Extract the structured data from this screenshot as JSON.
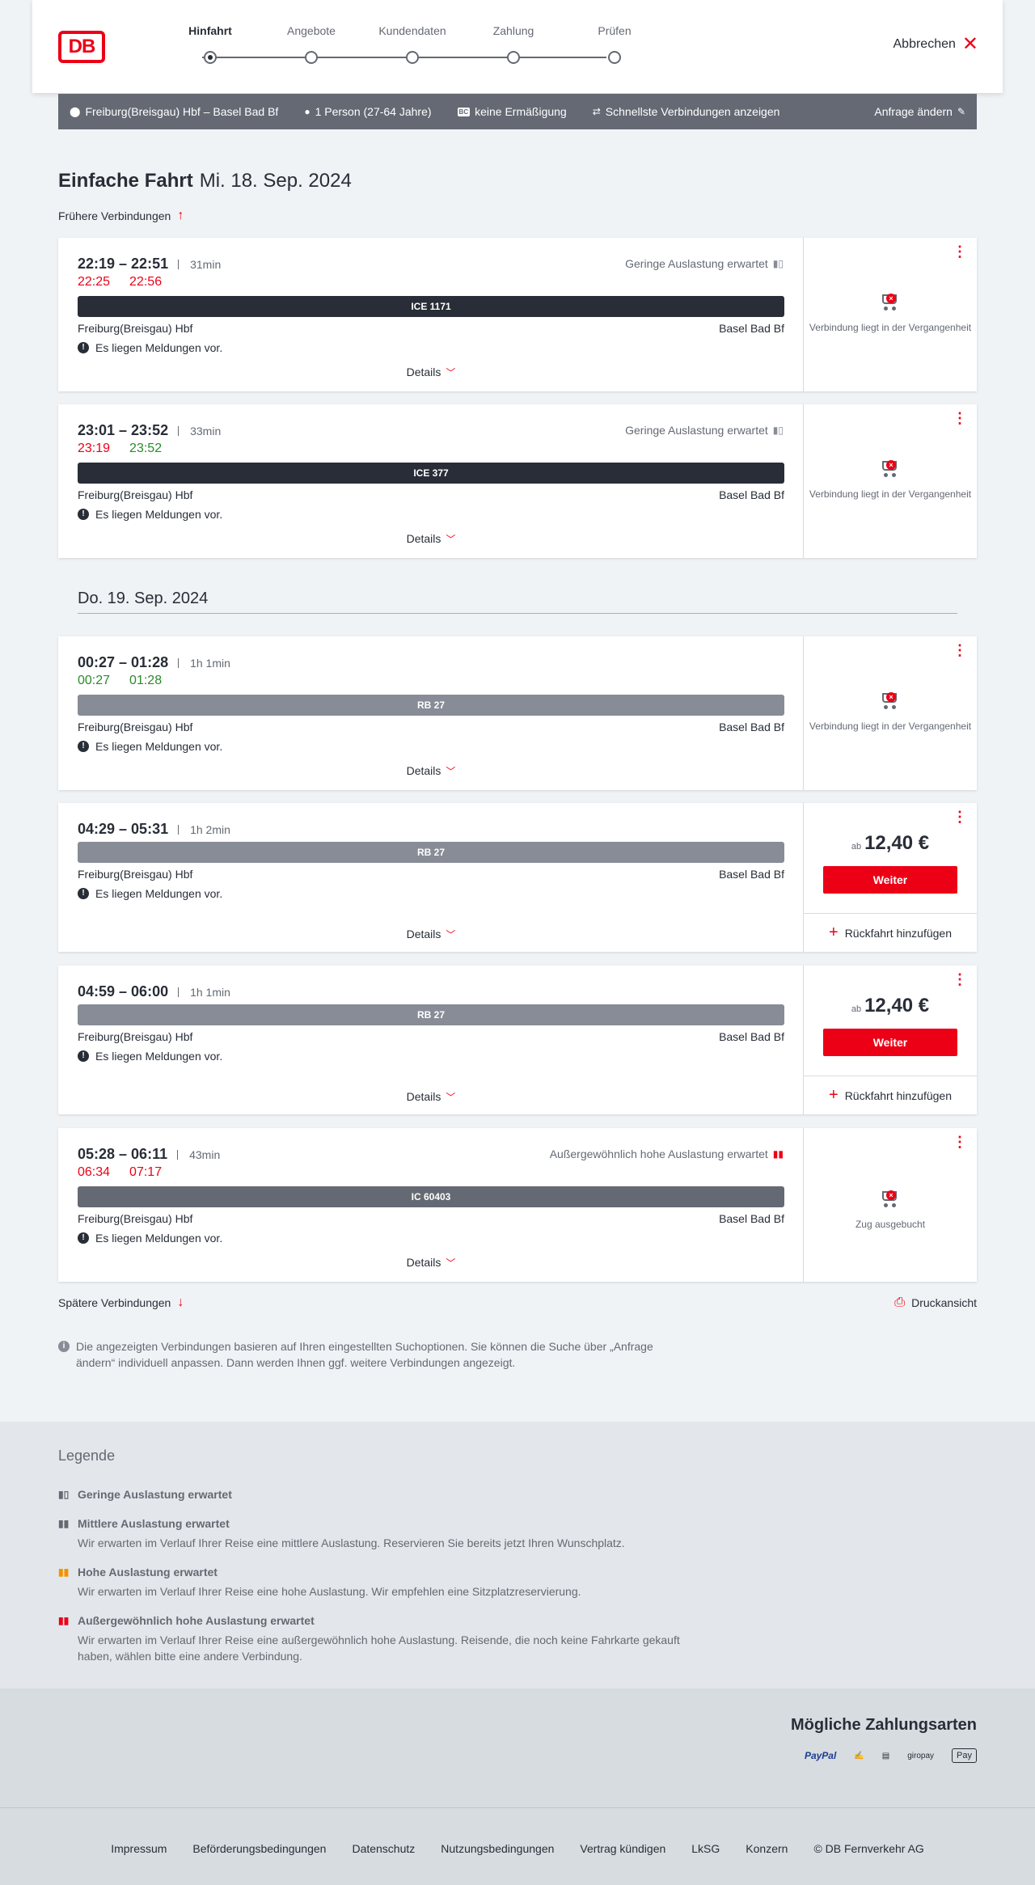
{
  "header": {
    "logo": "DB",
    "steps": [
      {
        "label": "Hinfahrt"
      },
      {
        "label": "Angebote"
      },
      {
        "label": "Kundendaten"
      },
      {
        "label": "Zahlung"
      },
      {
        "label": "Prüfen"
      }
    ],
    "cancel_label": "Abbrechen"
  },
  "search": {
    "route": "Freiburg(Breisgau) Hbf – Basel Bad Bf",
    "travellers": "1 Person (27-64 Jahre)",
    "discount_badge": "BC",
    "discount": "keine Ermäßigung",
    "fastest": "Schnellste Verbindungen anzeigen",
    "change": "Anfrage ändern"
  },
  "page": {
    "title": "Einfache Fahrt",
    "date": "Mi. 18. Sep. 2024",
    "earlier": "Frühere Verbindungen",
    "date2": "Do. 19. Sep. 2024",
    "later": "Spätere Verbindungen",
    "print": "Druckansicht",
    "info": "Die angezeigten Verbindungen basieren auf Ihren eingestellten Suchoptionen. Sie können die Suche über „Anfrage ändern“ individuell anpassen. Dann werden Ihnen ggf. weitere Verbindungen angezeigt."
  },
  "connections": [
    {
      "times": "22:19 – 22:51",
      "duration": "31min",
      "rt_dep": "22:25",
      "rt_arr": "22:56",
      "load": "Geringe Auslastung erwartet",
      "train": "ICE 1171",
      "from": "Freiburg(Breisgau) Hbf",
      "to": "Basel Bad Bf",
      "message": "Es liegen Meldungen vor.",
      "details": "Details",
      "status": "Verbindung liegt in der Vergangenheit"
    },
    {
      "times": "23:01 – 23:52",
      "duration": "33min",
      "rt_dep": "23:19",
      "rt_arr": "23:52",
      "load": "Geringe Auslastung erwartet",
      "train": "ICE 377",
      "from": "Freiburg(Breisgau) Hbf",
      "to": "Basel Bad Bf",
      "message": "Es liegen Meldungen vor.",
      "details": "Details",
      "status": "Verbindung liegt in der Vergangenheit"
    },
    {
      "times": "00:27 – 01:28",
      "duration": "1h 1min",
      "rt_dep": "00:27",
      "rt_arr": "01:28",
      "train": "RB 27",
      "from": "Freiburg(Breisgau) Hbf",
      "to": "Basel Bad Bf",
      "message": "Es liegen Meldungen vor.",
      "details": "Details",
      "status": "Verbindung liegt in der Vergangenheit"
    },
    {
      "times": "04:29 – 05:31",
      "duration": "1h 2min",
      "train": "RB 27",
      "from": "Freiburg(Breisgau) Hbf",
      "to": "Basel Bad Bf",
      "message": "Es liegen Meldungen vor.",
      "details": "Details",
      "price_prefix": "ab",
      "price": "12,40 €",
      "continue": "Weiter",
      "return": "Rückfahrt hinzufügen"
    },
    {
      "times": "04:59 – 06:00",
      "duration": "1h 1min",
      "train": "RB 27",
      "from": "Freiburg(Breisgau) Hbf",
      "to": "Basel Bad Bf",
      "message": "Es liegen Meldungen vor.",
      "details": "Details",
      "price_prefix": "ab",
      "price": "12,40 €",
      "continue": "Weiter",
      "return": "Rückfahrt hinzufügen"
    },
    {
      "times": "05:28 – 06:11",
      "duration": "43min",
      "rt_dep": "06:34",
      "rt_arr": "07:17",
      "load": "Außergewöhnlich hohe Auslastung erwartet",
      "train": "IC 60403",
      "from": "Freiburg(Breisgau) Hbf",
      "to": "Basel Bad Bf",
      "message": "Es liegen Meldungen vor.",
      "details": "Details",
      "status": "Zug ausgebucht"
    }
  ],
  "legend": {
    "title": "Legende",
    "items": [
      {
        "title": "Geringe Auslastung erwartet",
        "desc": ""
      },
      {
        "title": "Mittlere Auslastung erwartet",
        "desc": "Wir erwarten im Verlauf Ihrer Reise eine mittlere Auslastung. Reservieren Sie bereits jetzt Ihren Wunschplatz."
      },
      {
        "title": "Hohe Auslastung erwartet",
        "desc": "Wir erwarten im Verlauf Ihrer Reise eine hohe Auslastung. Wir empfehlen eine Sitzplatzreservierung."
      },
      {
        "title": "Außergewöhnlich hohe Auslastung erwartet",
        "desc": "Wir erwarten im Verlauf Ihrer Reise eine außergewöhnlich hohe Auslastung. Reisende, die noch keine Fahrkarte gekauft haben, wählen bitte eine andere Verbindung."
      }
    ]
  },
  "payment": {
    "title": "Mögliche Zahlungsarten",
    "methods": [
      "PayPal",
      "giropay",
      "Pay"
    ]
  },
  "footer": {
    "links": [
      "Impressum",
      "Beförderungsbedingungen",
      "Datenschutz",
      "Nutzungsbedingungen",
      "Vertrag kündigen",
      "LkSG",
      "Konzern",
      "© DB Fernverkehr AG"
    ]
  },
  "colors": {
    "accent": "#ec0016",
    "bar": "#646973",
    "late": "#ec0016",
    "ontime": "#2a8a2a"
  }
}
